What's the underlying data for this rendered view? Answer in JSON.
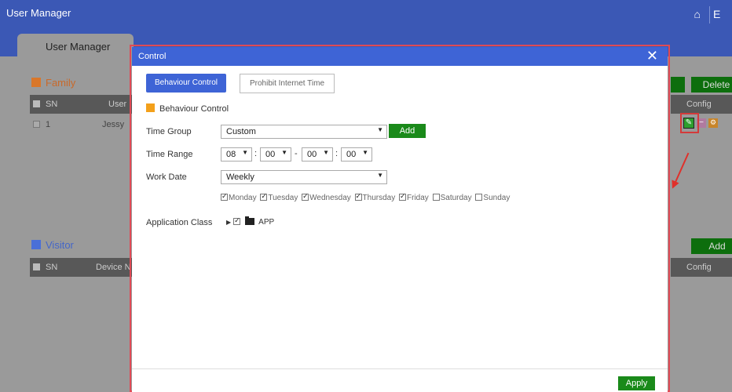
{
  "app": {
    "title": "User Manager",
    "home_icon": "home-icon",
    "top_right_glyph": "E"
  },
  "main_tab": {
    "label": "User Manager"
  },
  "family": {
    "heading": "Family",
    "icon": "home-icon",
    "columns": [
      "SN",
      "User"
    ],
    "rows": [
      {
        "sn": "1",
        "user": "Jessy"
      }
    ],
    "delete_label": "Delete",
    "config_header": "Config"
  },
  "visitor": {
    "heading": "Visitor",
    "columns": [
      "SN",
      "Device N"
    ],
    "add_label": "Add",
    "config_header": "Config"
  },
  "modal": {
    "title": "Control",
    "close_glyph": "✕",
    "tabs": [
      {
        "label": "Behaviour Control",
        "active": true
      },
      {
        "label": "Prohibit Internet Time",
        "active": false
      }
    ],
    "section_label": "Behaviour Control",
    "time_group": {
      "label": "Time Group",
      "value": "Custom",
      "add_label": "Add"
    },
    "time_range": {
      "label": "Time Range",
      "start_hour": "08",
      "start_min": "00",
      "end_hour": "00",
      "end_min": "00",
      "colon": ":",
      "dash": "-"
    },
    "work_date": {
      "label": "Work Date",
      "value": "Weekly"
    },
    "days": [
      {
        "name": "Monday",
        "checked": true
      },
      {
        "name": "Tuesday",
        "checked": true
      },
      {
        "name": "Wednesday",
        "checked": true
      },
      {
        "name": "Thursday",
        "checked": true
      },
      {
        "name": "Friday",
        "checked": true
      },
      {
        "name": "Saturday",
        "checked": false
      },
      {
        "name": "Sunday",
        "checked": false
      }
    ],
    "application_class": {
      "label": "Application Class",
      "node": "APP",
      "checked": true
    },
    "apply_label": "Apply"
  },
  "colors": {
    "topbar": "#3b58b5",
    "modal_header": "#3e64d6",
    "green_button": "#1a8a1a",
    "section_square": "#f3a01b",
    "highlight": "#e04a55"
  }
}
